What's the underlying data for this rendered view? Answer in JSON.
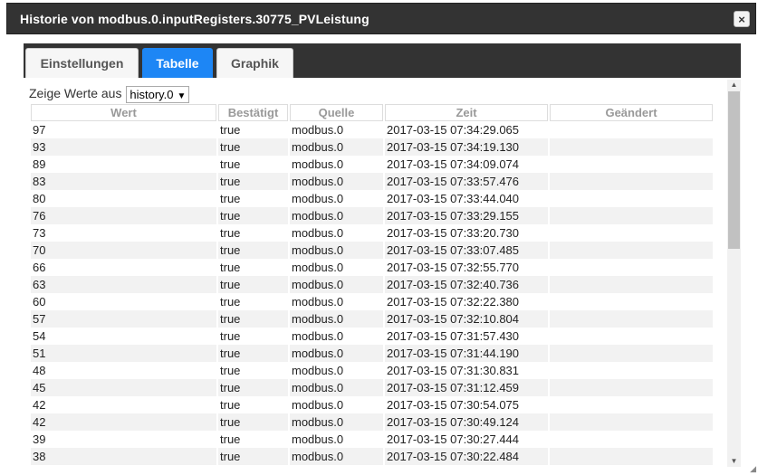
{
  "dialog": {
    "title": "Historie von modbus.0.inputRegisters.30775_PVLeistung",
    "close_label": "×"
  },
  "tabs": [
    {
      "label": "Einstellungen",
      "active": false
    },
    {
      "label": "Tabelle",
      "active": true
    },
    {
      "label": "Graphik",
      "active": false
    }
  ],
  "source": {
    "label": "Zeige Werte aus",
    "selected": "history.0"
  },
  "table": {
    "columns": [
      "Wert",
      "Bestätigt",
      "Quelle",
      "Zeit",
      "Geändert"
    ],
    "rows": [
      [
        "97",
        "true",
        "modbus.0",
        "2017-03-15 07:34:29.065",
        ""
      ],
      [
        "93",
        "true",
        "modbus.0",
        "2017-03-15 07:34:19.130",
        ""
      ],
      [
        "89",
        "true",
        "modbus.0",
        "2017-03-15 07:34:09.074",
        ""
      ],
      [
        "83",
        "true",
        "modbus.0",
        "2017-03-15 07:33:57.476",
        ""
      ],
      [
        "80",
        "true",
        "modbus.0",
        "2017-03-15 07:33:44.040",
        ""
      ],
      [
        "76",
        "true",
        "modbus.0",
        "2017-03-15 07:33:29.155",
        ""
      ],
      [
        "73",
        "true",
        "modbus.0",
        "2017-03-15 07:33:20.730",
        ""
      ],
      [
        "70",
        "true",
        "modbus.0",
        "2017-03-15 07:33:07.485",
        ""
      ],
      [
        "66",
        "true",
        "modbus.0",
        "2017-03-15 07:32:55.770",
        ""
      ],
      [
        "63",
        "true",
        "modbus.0",
        "2017-03-15 07:32:40.736",
        ""
      ],
      [
        "60",
        "true",
        "modbus.0",
        "2017-03-15 07:32:22.380",
        ""
      ],
      [
        "57",
        "true",
        "modbus.0",
        "2017-03-15 07:32:10.804",
        ""
      ],
      [
        "54",
        "true",
        "modbus.0",
        "2017-03-15 07:31:57.430",
        ""
      ],
      [
        "51",
        "true",
        "modbus.0",
        "2017-03-15 07:31:44.190",
        ""
      ],
      [
        "48",
        "true",
        "modbus.0",
        "2017-03-15 07:31:30.831",
        ""
      ],
      [
        "45",
        "true",
        "modbus.0",
        "2017-03-15 07:31:12.459",
        ""
      ],
      [
        "42",
        "true",
        "modbus.0",
        "2017-03-15 07:30:54.075",
        ""
      ],
      [
        "42",
        "true",
        "modbus.0",
        "2017-03-15 07:30:49.124",
        ""
      ],
      [
        "39",
        "true",
        "modbus.0",
        "2017-03-15 07:30:27.444",
        ""
      ],
      [
        "38",
        "true",
        "modbus.0",
        "2017-03-15 07:30:22.484",
        ""
      ]
    ]
  },
  "colors": {
    "titlebar": "#333333",
    "active_tab": "#1d86f5"
  }
}
